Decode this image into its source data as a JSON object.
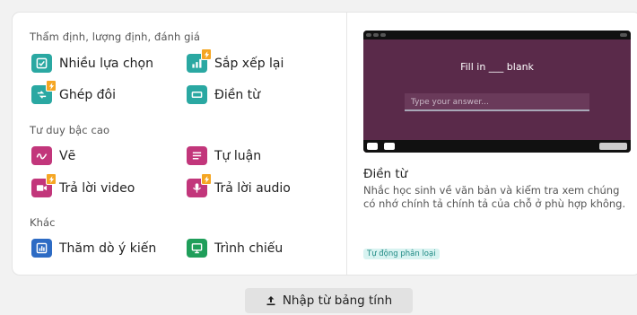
{
  "sections": [
    {
      "title": "Thẩm định, lượng định, đánh giá",
      "items": [
        {
          "label": "Nhiều lựa chọn",
          "icon": "checkbox-icon",
          "color": "#2aa8a2",
          "premium": false
        },
        {
          "label": "Sắp xếp lại",
          "icon": "bar-chart-icon",
          "color": "#2aa8a2",
          "premium": true
        },
        {
          "label": "Ghép đôi",
          "icon": "match-icon",
          "color": "#2aa8a2",
          "premium": true
        },
        {
          "label": "Điền từ",
          "icon": "blank-field-icon",
          "color": "#2aa8a2",
          "premium": false
        }
      ]
    },
    {
      "title": "Tư duy bậc cao",
      "items": [
        {
          "label": "Vẽ",
          "icon": "draw-icon",
          "color": "#c2367b",
          "premium": false
        },
        {
          "label": "Tự luận",
          "icon": "text-lines-icon",
          "color": "#c2367b",
          "premium": false
        },
        {
          "label": "Trả lời video",
          "icon": "video-icon",
          "color": "#c2367b",
          "premium": true
        },
        {
          "label": "Trả lời audio",
          "icon": "microphone-icon",
          "color": "#c2367b",
          "premium": true
        }
      ]
    },
    {
      "title": "Khác",
      "items": [
        {
          "label": "Thăm dò ý kiến",
          "icon": "poll-icon",
          "color": "#2d6bc4",
          "premium": false
        },
        {
          "label": "Trình chiếu",
          "icon": "presentation-icon",
          "color": "#1f9e5a",
          "premium": false
        }
      ]
    }
  ],
  "preview": {
    "question": "Fill in ___ blank",
    "input_placeholder": "Type your answer..."
  },
  "detail": {
    "title": "Điền từ",
    "description": "Nhắc học sinh về văn bản và kiểm tra xem chúng có nhớ chính tả chính tả của chỗ ở phù hợp không.",
    "badge": "Tự động phân loại"
  },
  "import_button": {
    "label": "Nhập từ bảng tính",
    "icon": "upload-icon"
  }
}
